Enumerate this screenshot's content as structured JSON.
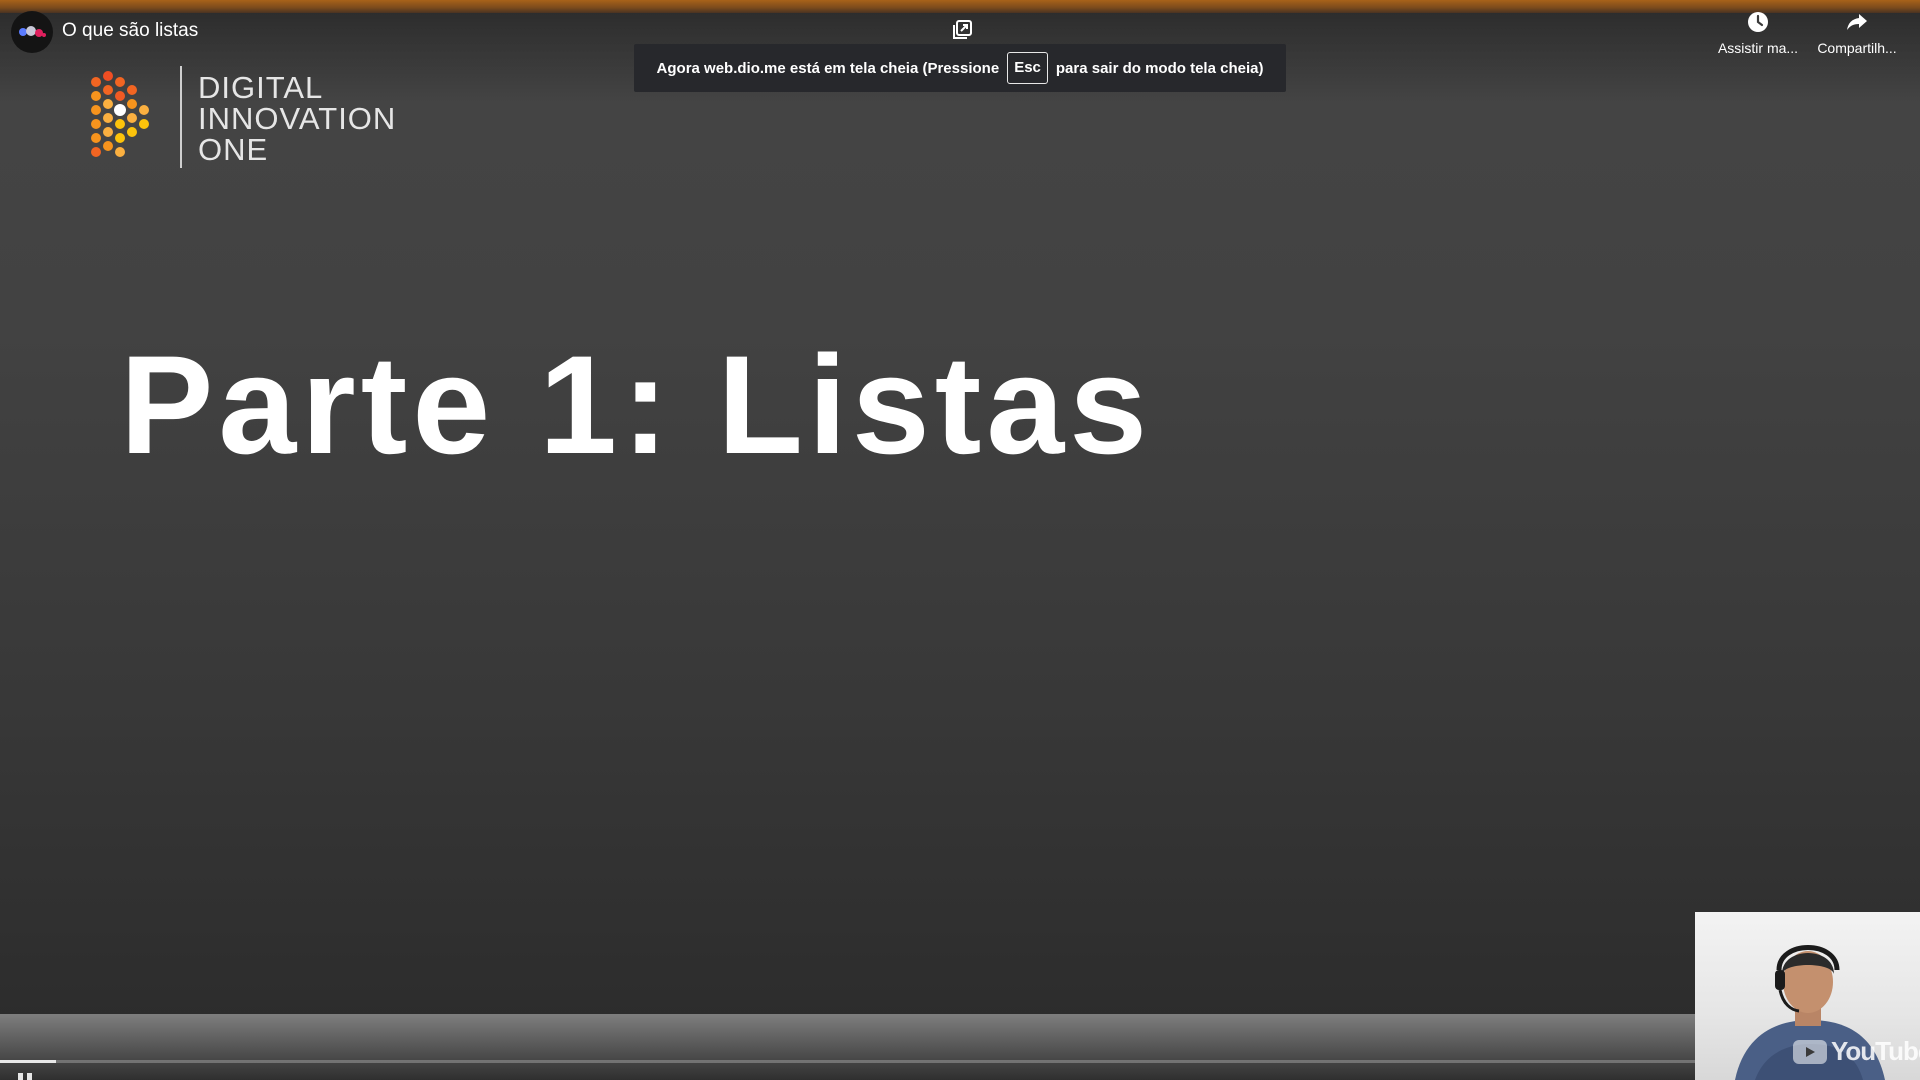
{
  "header": {
    "video_title": "O que são listas",
    "channel_avatar_icon": "dio-channel-avatar-icon",
    "miniplayer_icon": "miniplayer-icon",
    "actions": [
      {
        "label": "Assistir ma...",
        "icon": "clock-icon"
      },
      {
        "label": "Compartilh...",
        "icon": "share-arrow-icon"
      }
    ]
  },
  "fullscreen_notice": {
    "before": "Agora web.dio.me está em tela cheia (Pressione",
    "key": "Esc",
    "after": "para sair do modo tela cheia)"
  },
  "slide": {
    "logo_lines": [
      "DIGITAL",
      "INNOVATION",
      "ONE"
    ],
    "heading": "Parte 1: Listas"
  },
  "player": {
    "progress_fraction": 0.033,
    "watermark_text": "YouTube",
    "play_state_icon": "pause-icon"
  },
  "colors": {
    "accent_bar": "#a8621a",
    "slide_background": "#424242",
    "logo_orange": "#f26522",
    "logo_yellow": "#fbb040"
  }
}
